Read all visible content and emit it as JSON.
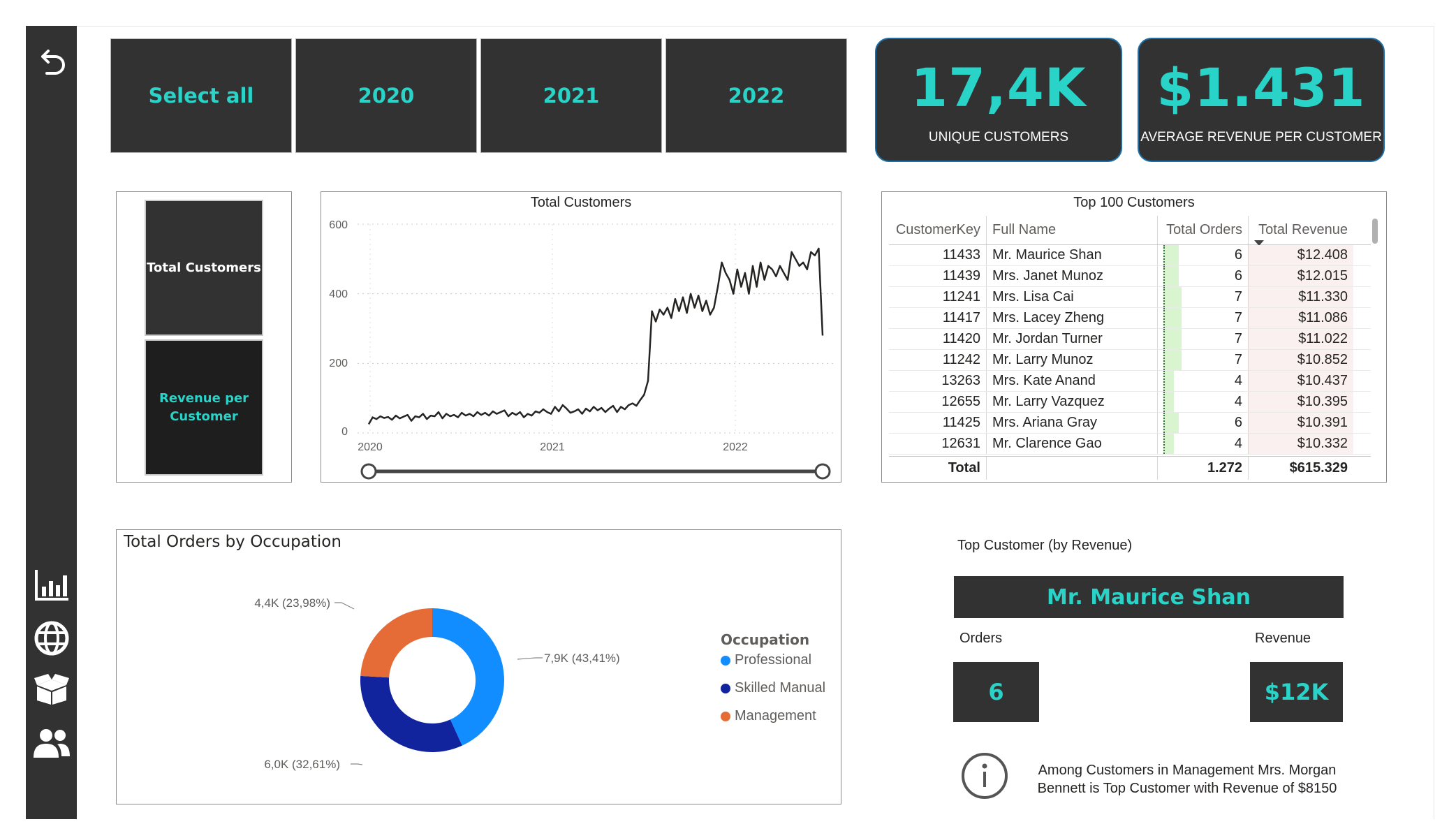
{
  "sidebar": {
    "icons": [
      "back-arrow-icon",
      "bar-chart-icon",
      "globe-icon",
      "box-icon",
      "users-icon"
    ]
  },
  "year_slicer": {
    "items": [
      "Select all",
      "2020",
      "2021",
      "2022"
    ]
  },
  "kpis": {
    "unique_customers": {
      "value": "17,4K",
      "label": "UNIQUE CUSTOMERS"
    },
    "avg_revenue": {
      "value": "$1.431",
      "label": "AVERAGE REVENUE PER CUSTOMER"
    }
  },
  "measure_switch": {
    "total_customers": "Total Customers",
    "revenue_per_customer": "Revenue per Customer"
  },
  "line_chart": {
    "title": "Total Customers",
    "y_ticks": [
      "600",
      "400",
      "200",
      "0"
    ],
    "x_ticks": [
      "2020",
      "2021",
      "2022"
    ]
  },
  "chart_data": [
    {
      "type": "line",
      "title": "Total Customers",
      "xlabel": "",
      "ylabel": "",
      "ylim": [
        0,
        600
      ],
      "x_ticks": [
        "2020",
        "2021",
        "2022"
      ],
      "grid": true,
      "series": [
        {
          "values": [
            25,
            45,
            40,
            48,
            43,
            46,
            38,
            50,
            42,
            47,
            52,
            35,
            48,
            45,
            55,
            40,
            50,
            48,
            60,
            42,
            55,
            48,
            52,
            45,
            58,
            50,
            55,
            48,
            60,
            52,
            58,
            50,
            62,
            55,
            60,
            65,
            48,
            58,
            52,
            60,
            45,
            55,
            50,
            62,
            58,
            68,
            60,
            55,
            75,
            62,
            80,
            70,
            58,
            62,
            68,
            55,
            70,
            62,
            75,
            65,
            72,
            60,
            70,
            78,
            60,
            75,
            68,
            80,
            85,
            78,
            95,
            110,
            150,
            350,
            320,
            355,
            340,
            360,
            330,
            385,
            350,
            390,
            345,
            400,
            360,
            395,
            350,
            380,
            340,
            360,
            420,
            490,
            460,
            440,
            400,
            470,
            420,
            460,
            400,
            480,
            420,
            490,
            440,
            480,
            470,
            450,
            480,
            460,
            440,
            520,
            500,
            480,
            490,
            470,
            520,
            510,
            530,
            280
          ]
        }
      ]
    },
    {
      "type": "pie",
      "title": "Total Orders by Occupation",
      "legend_title": "Occupation",
      "categories": [
        "Professional",
        "Skilled Manual",
        "Management"
      ],
      "values": [
        7900,
        6000,
        4400
      ],
      "percentages": [
        43.41,
        32.61,
        23.98
      ],
      "colors": [
        "#118dff",
        "#12239e",
        "#e66c37"
      ]
    }
  ],
  "top100": {
    "title": "Top 100 Customers",
    "columns": [
      "CustomerKey",
      "Full Name",
      "Total Orders",
      "Total Revenue"
    ],
    "rows": [
      {
        "key": "11433",
        "name": "Mr. Maurice Shan",
        "orders": "6",
        "orders_n": 6,
        "revenue": "$12.408"
      },
      {
        "key": "11439",
        "name": "Mrs. Janet Munoz",
        "orders": "6",
        "orders_n": 6,
        "revenue": "$12.015"
      },
      {
        "key": "11241",
        "name": "Mrs. Lisa Cai",
        "orders": "7",
        "orders_n": 7,
        "revenue": "$11.330"
      },
      {
        "key": "11417",
        "name": "Mrs. Lacey Zheng",
        "orders": "7",
        "orders_n": 7,
        "revenue": "$11.086"
      },
      {
        "key": "11420",
        "name": "Mr. Jordan Turner",
        "orders": "7",
        "orders_n": 7,
        "revenue": "$11.022"
      },
      {
        "key": "11242",
        "name": "Mr. Larry Munoz",
        "orders": "7",
        "orders_n": 7,
        "revenue": "$10.852"
      },
      {
        "key": "13263",
        "name": "Mrs. Kate Anand",
        "orders": "4",
        "orders_n": 4,
        "revenue": "$10.437"
      },
      {
        "key": "12655",
        "name": "Mr. Larry Vazquez",
        "orders": "4",
        "orders_n": 4,
        "revenue": "$10.395"
      },
      {
        "key": "11425",
        "name": "Mrs. Ariana Gray",
        "orders": "6",
        "orders_n": 6,
        "revenue": "$10.391"
      },
      {
        "key": "12631",
        "name": "Mr. Clarence Gao",
        "orders": "4",
        "orders_n": 4,
        "revenue": "$10.332"
      }
    ],
    "total": {
      "label": "Total",
      "orders": "1.272",
      "revenue": "$615.329"
    }
  },
  "donut": {
    "title": "Total Orders by Occupation",
    "legend_title": "Occupation",
    "legend": [
      "Professional",
      "Skilled Manual",
      "Management"
    ],
    "labels": [
      "7,9K (43,41%)",
      "6,0K (32,61%)",
      "4,4K (23,98%)"
    ]
  },
  "top_customer": {
    "heading": "Top Customer (by Revenue)",
    "name": "Mr. Maurice Shan",
    "orders_label": "Orders",
    "orders_value": "6",
    "revenue_label": "Revenue",
    "revenue_value": "$12K",
    "info": "Among Customers in Management Mrs. Morgan Bennett is Top Customer with Revenue of $8150"
  },
  "colors": {
    "accent": "#29d3c8",
    "tile": "#323232",
    "line": "#252423",
    "professional": "#118dff",
    "skilled_manual": "#12239e",
    "management": "#e66c37"
  }
}
